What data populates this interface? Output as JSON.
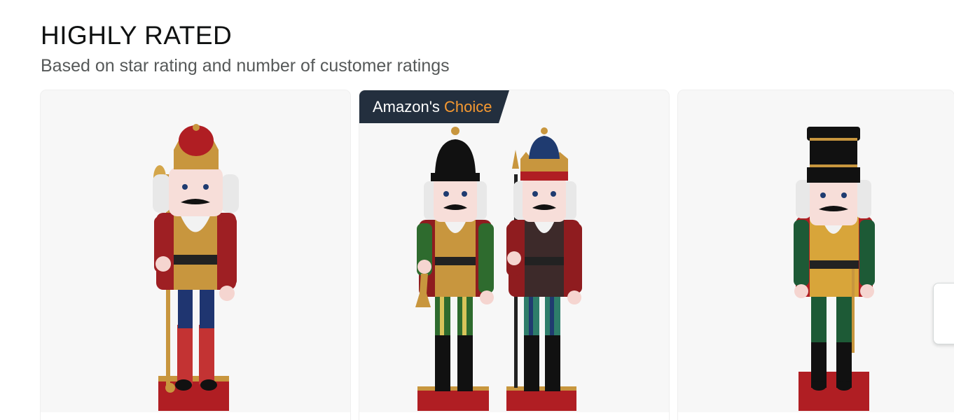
{
  "section": {
    "title": "HIGHLY RATED",
    "subtitle": "Based on star rating and number of customer ratings"
  },
  "products": [
    {
      "name_icon": "nutcracker-king-scepter-image",
      "badge": null
    },
    {
      "name_icon": "nutcracker-pair-image",
      "badge": {
        "prefix": "Amazon's",
        "highlight": "Choice"
      }
    },
    {
      "name_icon": "nutcracker-soldier-black-hat-image",
      "badge": null
    }
  ],
  "colors": {
    "badge_bg": "#232f3e",
    "badge_highlight": "#f69931",
    "card_bg": "#f7f7f7"
  },
  "icons": {
    "scroll_next": "chevron-right-icon"
  }
}
